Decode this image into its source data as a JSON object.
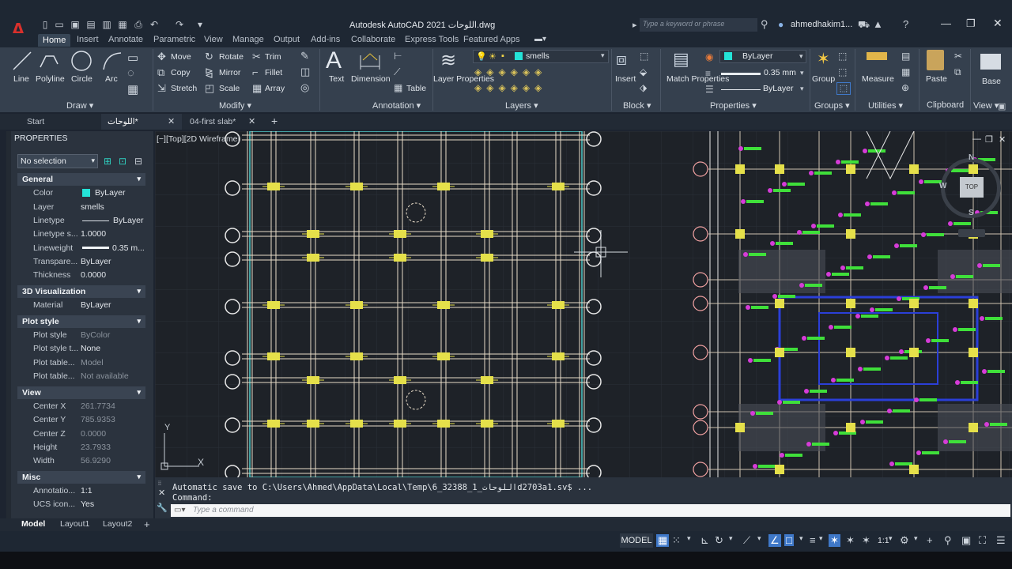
{
  "window": {
    "title": "Autodesk AutoCAD 2021   اللوحات.dwg",
    "search_placeholder": "Type a keyword or phrase",
    "user": "ahmedhakim1..."
  },
  "app_logo": "A",
  "ribbon_tabs": [
    "Home",
    "Insert",
    "Annotate",
    "Parametric",
    "View",
    "Manage",
    "Output",
    "Add-ins",
    "Collaborate",
    "Express Tools",
    "Featured Apps"
  ],
  "ribbon": {
    "draw": {
      "line": "Line",
      "polyline": "Polyline",
      "circle": "Circle",
      "arc": "Arc",
      "group": "Draw"
    },
    "modify": {
      "move": "Move",
      "rotate": "Rotate",
      "trim": "Trim",
      "copy": "Copy",
      "mirror": "Mirror",
      "fillet": "Fillet",
      "stretch": "Stretch",
      "scale": "Scale",
      "array": "Array",
      "group": "Modify"
    },
    "annotation": {
      "text": "Text",
      "dimension": "Dimension",
      "table": "Table",
      "group": "Annotation"
    },
    "layers": {
      "layer_properties": "Layer Properties",
      "current_layer": "smells",
      "group": "Layers"
    },
    "block": {
      "insert": "Insert",
      "group": "Block"
    },
    "properties": {
      "match": "Match Properties",
      "color": "ByLayer",
      "lineweight": "0.35 mm",
      "linetype": "ByLayer",
      "group": "Properties"
    },
    "groups": {
      "group": "Group",
      "label": "Groups"
    },
    "utilities": {
      "measure": "Measure",
      "label": "Utilities"
    },
    "clipboard": {
      "paste": "Paste",
      "label": "Clipboard"
    },
    "view": {
      "base": "Base",
      "label": "View"
    }
  },
  "doc_tabs": [
    "Start",
    "اللوحات*",
    "04-first slab*"
  ],
  "properties_panel": {
    "title": "PROPERTIES",
    "selection": "No selection",
    "sections": {
      "general": "General",
      "viz3d": "3D Visualization",
      "plot": "Plot style",
      "view": "View",
      "misc": "Misc"
    },
    "general": [
      {
        "label": "Color",
        "value": "ByLayer"
      },
      {
        "label": "Layer",
        "value": "smells"
      },
      {
        "label": "Linetype",
        "value": "ByLayer"
      },
      {
        "label": "Linetype s...",
        "value": "1.0000"
      },
      {
        "label": "Lineweight",
        "value": "0.35 m..."
      },
      {
        "label": "Transpare...",
        "value": "ByLayer"
      },
      {
        "label": "Thickness",
        "value": "0.0000"
      }
    ],
    "viz3d": [
      {
        "label": "Material",
        "value": "ByLayer"
      }
    ],
    "plot": [
      {
        "label": "Plot style",
        "value": "ByColor"
      },
      {
        "label": "Plot style t...",
        "value": "None"
      },
      {
        "label": "Plot table...",
        "value": "Model"
      },
      {
        "label": "Plot table...",
        "value": "Not available"
      }
    ],
    "view": [
      {
        "label": "Center X",
        "value": "261.7734"
      },
      {
        "label": "Center Y",
        "value": "785.9353"
      },
      {
        "label": "Center Z",
        "value": "0.0000"
      },
      {
        "label": "Height",
        "value": "23.7933"
      },
      {
        "label": "Width",
        "value": "56.9290"
      }
    ],
    "misc": [
      {
        "label": "Annotatio...",
        "value": "1:1"
      },
      {
        "label": "UCS icon...",
        "value": "Yes"
      }
    ]
  },
  "viewport_label": "[−][Top][2D Wireframe]",
  "viewcube": {
    "n": "N",
    "w": "W",
    "s": "S",
    "top": "TOP"
  },
  "ucs": {
    "x": "X",
    "y": "Y"
  },
  "command": {
    "history1": "Automatic save to C:\\Users\\Ahmed\\AppData\\Local\\Temp\\6_32388_1_اللوحاتd2703a1.sv$ ...",
    "history2": "Command:",
    "placeholder": "Type a command"
  },
  "layout_tabs": [
    "Model",
    "Layout1",
    "Layout2"
  ],
  "status": {
    "model": "MODEL",
    "scale": "1:1"
  },
  "colors": {
    "accent": "#3f78c8",
    "ribbon": "#35404e",
    "canvas": "#1e2228"
  }
}
